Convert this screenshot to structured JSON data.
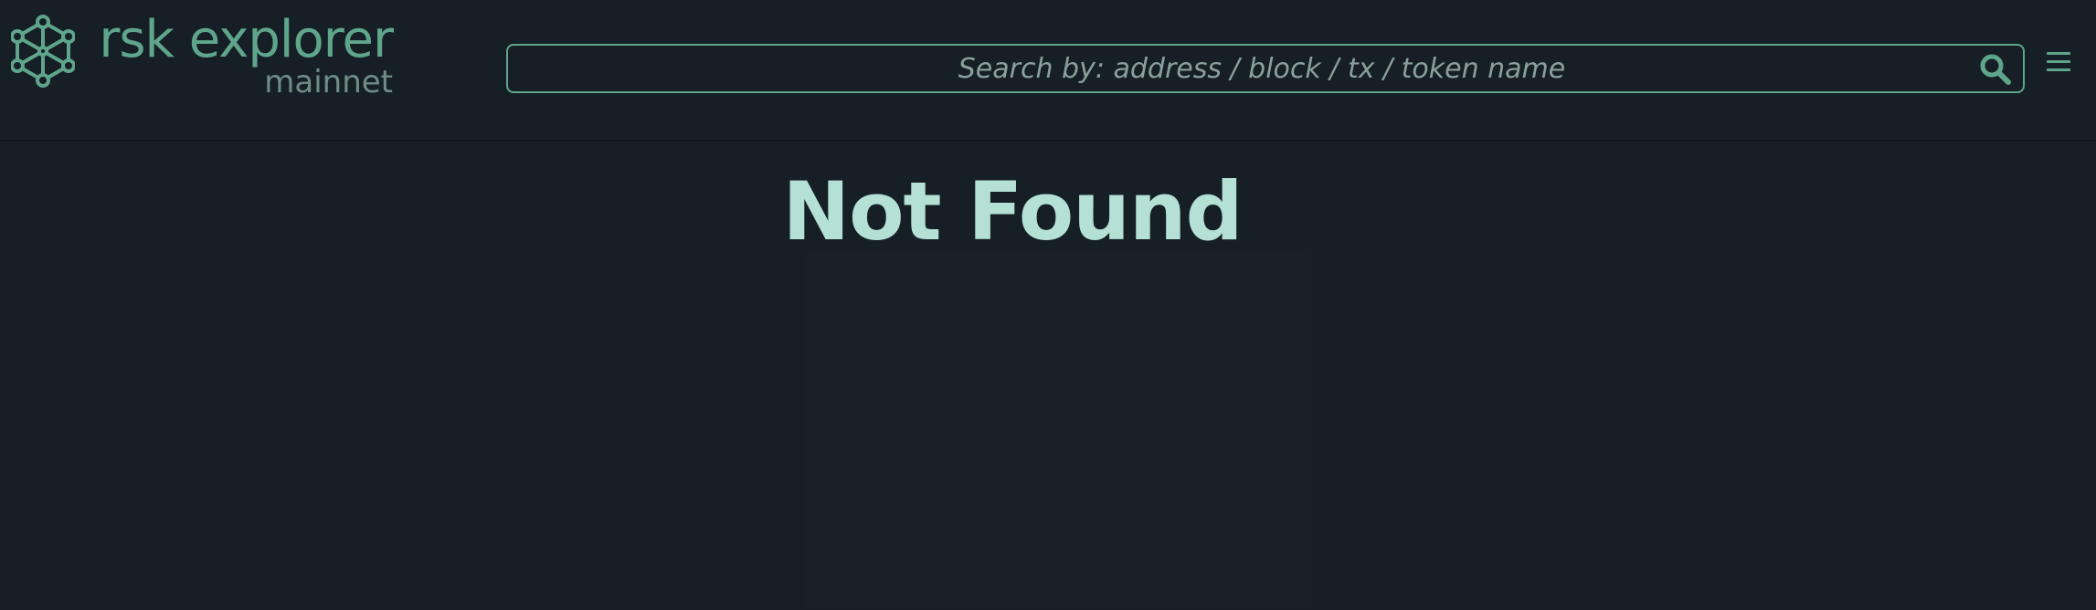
{
  "app": {
    "name": "rsk explorer",
    "network": "mainnet"
  },
  "header": {
    "logo_icon": "rsk-network-hex-icon",
    "search_placeholder": "Search by: address / block / tx / token name",
    "search_value": "",
    "search_icon": "search-icon",
    "menu_icon": "hamburger-menu-icon"
  },
  "main": {
    "title": "Not Found"
  },
  "colors": {
    "background": "#161f25",
    "accent": "#5fa58c",
    "heading": "#b4e0d6",
    "muted": "#6f8c87"
  }
}
